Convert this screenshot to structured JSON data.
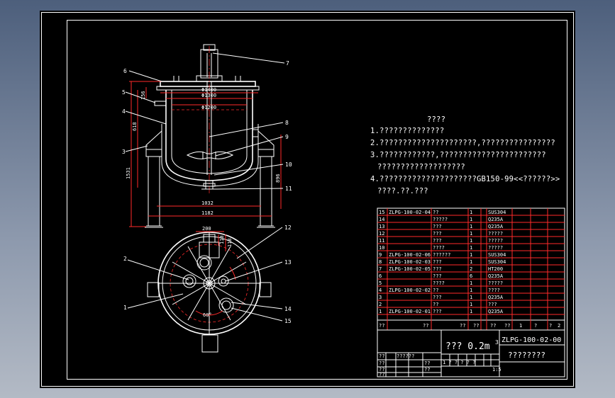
{
  "notes": {
    "title": "????",
    "line1": "1.??????????????",
    "line2": "2.?????????????????????,????????????????",
    "line3": "3.????????????,???????????????????????",
    "line3b": "???????????????????",
    "line4": "4.?????????????????????GB150-99<<??????>>",
    "line4b": "????.??.???"
  },
  "balloons": [
    "7",
    "6",
    "5",
    "4",
    "3",
    "8",
    "9",
    "10",
    "11",
    "2",
    "1",
    "12",
    "13",
    "14",
    "15"
  ],
  "dimensions": {
    "d1400": "Φ1400",
    "d1300": "Φ1300",
    "d1200": "Φ1200",
    "h618": "618",
    "h156": "156",
    "h1531": "1531",
    "h896": "896",
    "w1032": "1032",
    "w1182": "1182",
    "w200": "200",
    "h110": "110",
    "h118": "118",
    "ang60": "60°"
  },
  "bom": {
    "rows": [
      {
        "no": "15",
        "code": "ZLPG-100-02-04",
        "name": "??",
        "qty": "1",
        "mat": "SUS304"
      },
      {
        "no": "14",
        "code": "",
        "name": "?????",
        "qty": "1",
        "mat": "Q235A"
      },
      {
        "no": "13",
        "code": "",
        "name": "???",
        "qty": "1",
        "mat": "Q235A"
      },
      {
        "no": "12",
        "code": "",
        "name": "???",
        "qty": "1",
        "mat": "?????"
      },
      {
        "no": "11",
        "code": "",
        "name": "???",
        "qty": "1",
        "mat": "?????"
      },
      {
        "no": "10",
        "code": "",
        "name": "????",
        "qty": "1",
        "mat": "?????"
      },
      {
        "no": "9",
        "code": "ZLPG-100-02-06",
        "name": "??????",
        "qty": "1",
        "mat": "SUS304"
      },
      {
        "no": "8",
        "code": "ZLPG-100-02-03",
        "name": "???",
        "qty": "1",
        "mat": "SUS304"
      },
      {
        "no": "7",
        "code": "ZLPG-100-02-05",
        "name": "???",
        "qty": "2",
        "mat": "HT200"
      },
      {
        "no": "6",
        "code": "",
        "name": "???",
        "qty": "6",
        "mat": "Q235A"
      },
      {
        "no": "5",
        "code": "",
        "name": "????",
        "qty": "1",
        "mat": "?????"
      },
      {
        "no": "4",
        "code": "ZLPG-100-02-02",
        "name": "??",
        "qty": "1",
        "mat": "????"
      },
      {
        "no": "3",
        "code": "",
        "name": "???",
        "qty": "1",
        "mat": "Q235A"
      },
      {
        "no": "2",
        "code": "",
        "name": "??",
        "qty": "1",
        "mat": "???"
      },
      {
        "no": "1",
        "code": "ZLPG-100-02-01",
        "name": "???",
        "qty": "1",
        "mat": "Q235A"
      }
    ],
    "header": {
      "c1": "??",
      "c2": "??",
      "c3": "??",
      "c4": "??",
      "c5": "??",
      "c6": "??",
      "c7": "1",
      "c8": "?",
      "c9": "?",
      "c10": "2"
    }
  },
  "title_block": {
    "product": "???  0.2m",
    "sup": "3",
    "drawing_no": "ZLPG-100-02-00",
    "company": "????????",
    "scale": "1:5",
    "sig1": "??",
    "sig2": "??????",
    "sig3": "??",
    "sig4": "??",
    "sig5": "??",
    "sig6": "??",
    "sig7": "??",
    "small": "1 ? ? ? ? ?"
  }
}
